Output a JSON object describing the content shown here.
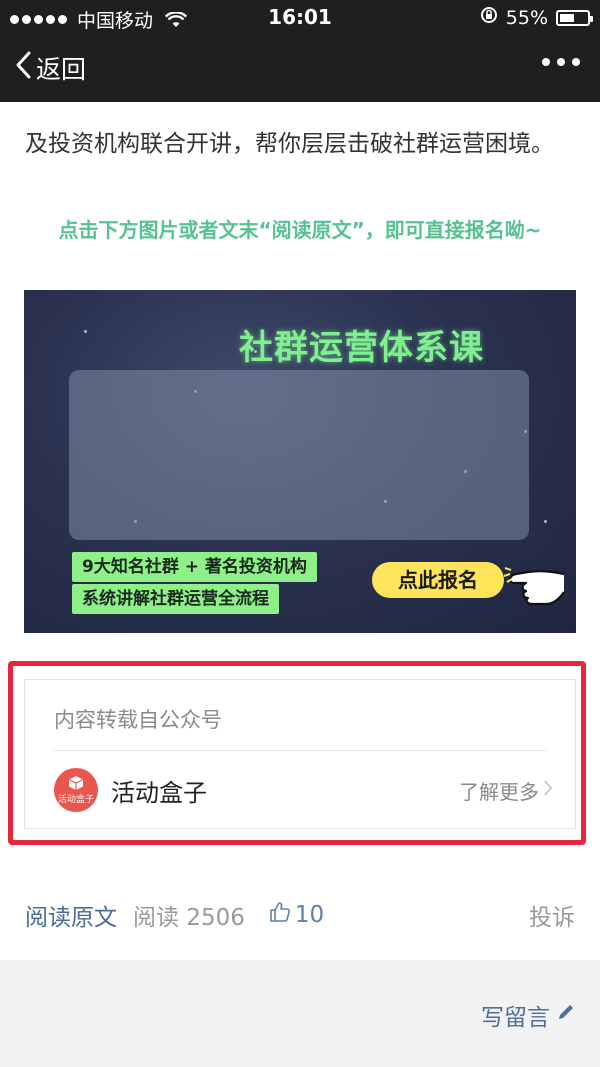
{
  "status_bar": {
    "carrier": "中国移动",
    "time": "16:01",
    "battery_percent_text": "55%",
    "battery_level": 0.55
  },
  "nav": {
    "back_label": "返回"
  },
  "article": {
    "paragraph": "及投资机构联合开讲，帮你层层击破社群运营困境。",
    "highlight": "点击下方图片或者文末“阅读原文”，即可直接报名呦~"
  },
  "banner": {
    "title": "社群运营体系课",
    "tag1": "9大知名社群 + 著名投资机构",
    "tag2": "系统讲解社群运营全流程",
    "signup_label": "点此报名"
  },
  "source": {
    "label": "内容转载自公众号",
    "account_name": "活动盒子",
    "avatar_text": "活动盒子",
    "learn_more": "了解更多"
  },
  "footer": {
    "read_original": "阅读原文",
    "reads": "阅读 2506",
    "likes": "10",
    "complain": "投诉"
  },
  "comment": {
    "write_label": "写留言"
  },
  "colors": {
    "accent_green": "#57c28f",
    "link_blue": "#4a6a9a",
    "highlight_red": "#e8283a"
  }
}
